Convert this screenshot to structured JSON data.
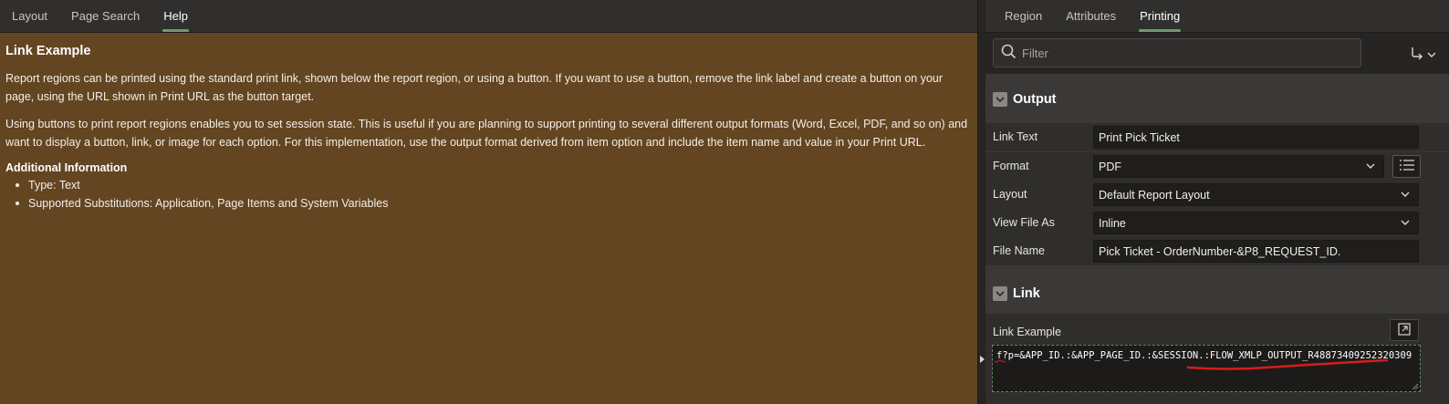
{
  "left_tabs": [
    "Layout",
    "Page Search",
    "Help"
  ],
  "right_tabs": [
    "Region",
    "Attributes",
    "Printing"
  ],
  "help": {
    "title": "Link Example",
    "para1": "Report regions can be printed using the standard print link, shown below the report region, or using a button. If you want to use a button, remove the link label and create a button on your page, using the URL shown in Print URL as the button target.",
    "para2": "Using buttons to print report regions enables you to set session state. This is useful if you are planning to support printing to several different output formats (Word, Excel, PDF, and so on) and want to display a button, link, or image for each option. For this implementation, use the output format derived from item option and include the item name and value in your Print URL.",
    "additional_heading": "Additional Information",
    "bullets": [
      "Type: Text",
      "Supported Substitutions: Application, Page Items and System Variables"
    ]
  },
  "filter": {
    "placeholder": "Filter"
  },
  "output": {
    "title": "Output",
    "rows": [
      {
        "label": "Link Text",
        "value": "Print Pick Ticket"
      },
      {
        "label": "Format",
        "value": "PDF"
      },
      {
        "label": "Layout",
        "value": "Default Report Layout"
      },
      {
        "label": "View File As",
        "value": "Inline"
      },
      {
        "label": "File Name",
        "value": "Pick Ticket - OrderNumber-&P8_REQUEST_ID."
      }
    ]
  },
  "link": {
    "title": "Link",
    "example_label": "Link Example",
    "example_value": "f?p=&APP_ID.:&APP_PAGE_ID.:&SESSION.:FLOW_XMLP_OUTPUT_R48873409252320309"
  },
  "colors": {
    "help_bg": "#634521",
    "accent": "#6c9a6f",
    "annotation": "#d81c1c"
  },
  "icons": [
    "search-icon",
    "goto-arrow-icon",
    "chevron-down-icon",
    "list-icon",
    "open-dialog-icon",
    "collapse-icon"
  ]
}
